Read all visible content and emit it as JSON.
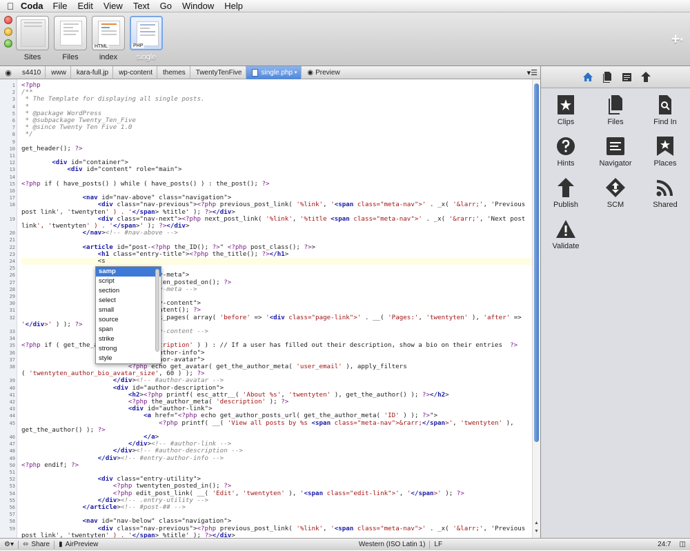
{
  "menubar": {
    "app": "Coda",
    "items": [
      "File",
      "Edit",
      "View",
      "Text",
      "Go",
      "Window",
      "Help"
    ]
  },
  "toolbar": {
    "buttons": [
      {
        "label": "Sites",
        "tag": ""
      },
      {
        "label": "Files",
        "tag": ""
      },
      {
        "label": "index",
        "tag": "HTML"
      },
      {
        "label": "single",
        "tag": "PHP"
      }
    ],
    "plus": "+"
  },
  "pathbar": {
    "crumbs": [
      "s4410",
      "www",
      "kara-full.jp",
      "wp-content",
      "themes",
      "TwentyTenFive"
    ],
    "current_file": "single.php",
    "preview_label": "Preview"
  },
  "editor": {
    "line_numbers": [
      "1",
      "2",
      "3",
      "4",
      "5",
      "6",
      "7",
      "8",
      "9",
      "10",
      "11",
      "12",
      "13",
      "14",
      "15",
      "16",
      "17",
      "18",
      "",
      "19",
      "",
      "20",
      "21",
      "22",
      "23",
      "24",
      "25",
      "26",
      "27",
      "28",
      "29",
      "30",
      "31",
      "32",
      "",
      "33",
      "34",
      "35",
      "36",
      "37",
      "38",
      "",
      "39",
      "40",
      "41",
      "42",
      "43",
      "44",
      "45",
      "",
      "46",
      "47",
      "48",
      "49",
      "50",
      "51",
      "52",
      "53",
      "54",
      "55",
      "56",
      "57",
      "58",
      "59",
      ""
    ],
    "lines": [
      "<?php",
      "/**",
      " * The Template for displaying all single posts.",
      " *",
      " * @package WordPress",
      " * @subpackage Twenty_Ten_Five",
      " * @since Twenty Ten Five 1.0",
      " */",
      "",
      "get_header(); ?>",
      "",
      "        <div id=\"container\">",
      "            <div id=\"content\" role=\"main\">",
      "",
      "<?php if ( have_posts() ) while ( have_posts() ) : the_post(); ?>",
      "",
      "                <nav id=\"nav-above\" class=\"navigation\">",
      "                    <div class=\"nav-previous\"><?php previous_post_link( '%link', '<span class=\"meta-nav\">' . _x( '&larr;', 'Previous",
      "post link', 'twentyten' ) . '</span> %title' ); ?></div>",
      "                    <div class=\"nav-next\"><?php next_post_link( '%link', '%title <span class=\"meta-nav\">' . _x( '&rarr;', 'Next post",
      "link', 'twentyten' ) . '</span>' ); ?></div>",
      "                </nav><!-- #nav-above -->",
      "",
      "                <article id=\"post-<?php the_ID(); ?>\" <?php post_class(); ?>>",
      "                    <h1 class=\"entry-title\"><?php the_title(); ?></h1>",
      "                    <s",
      "",
      "                    <div class=\"entry-meta\">",
      "                        <?php twentyten_posted_on(); ?>",
      "                    </div><!-- .entry-meta -->",
      "",
      "                    <div class=\"entry-content\">",
      "                        <?php the_content(); ?>",
      "                        <?php wp_link_pages( array( 'before' => '<div class=\"page-link\">' . __( 'Pages:', 'twentyten' ), 'after' =>",
      "'</div>' ) ); ?>",
      "                    </div><!-- .entry-content -->",
      "",
      "<?php if ( get_the_author_meta( 'description' ) ) : // If a user has filled out their description, show a bio on their entries  ?>",
      "                    <div id=\"entry-author-info\">",
      "                        <div id=\"author-avatar\">",
      "                            <?php echo get_avatar( get_the_author_meta( 'user_email' ), apply_filters",
      "( 'twentyten_author_bio_avatar_size', 60 ) ); ?>",
      "                        </div><!-- #author-avatar -->",
      "                        <div id=\"author-description\">",
      "                            <h2><?php printf( esc_attr__( 'About %s', 'twentyten' ), get_the_author() ); ?></h2>",
      "                            <?php the_author_meta( 'description' ); ?>",
      "                            <div id=\"author-link\">",
      "                                <a href=\"<?php echo get_author_posts_url( get_the_author_meta( 'ID' ) ); ?>\">",
      "                                    <?php printf( __( 'View all posts by %s <span class=\"meta-nav\">&rarr;</span>', 'twentyten' ),",
      "get_the_author() ); ?>",
      "                                </a>",
      "                            </div><!-- #author-link -->",
      "                        </div><!-- #author-description -->",
      "                    </div><!-- #entry-author-info -->",
      "<?php endif; ?>",
      "",
      "                    <div class=\"entry-utility\">",
      "                        <?php twentyten_posted_in(); ?>",
      "                        <?php edit_post_link( __( 'Edit', 'twentyten' ), '<span class=\"edit-link\">', '</span>' ); ?>",
      "                    </div><!-- .entry-utility -->",
      "                </article><!-- #post-## -->",
      "",
      "                <nav id=\"nav-below\" class=\"navigation\">",
      "                    <div class=\"nav-previous\"><?php previous_post_link( '%link', '<span class=\"meta-nav\">' . _x( '&larr;', 'Previous",
      "post link', 'twentyten' ) . '</span> %title' ); ?></div>"
    ],
    "current_line_index": 25
  },
  "autocomplete": {
    "items": [
      "samp",
      "script",
      "section",
      "select",
      "small",
      "source",
      "span",
      "strike",
      "strong",
      "style"
    ],
    "selected": 0
  },
  "sidebar": {
    "items": [
      {
        "label": "Clips",
        "icon": "clips-icon"
      },
      {
        "label": "Files",
        "icon": "files-icon"
      },
      {
        "label": "Find In",
        "icon": "find-in-icon"
      },
      {
        "label": "Hints",
        "icon": "hints-icon"
      },
      {
        "label": "Navigator",
        "icon": "navigator-icon"
      },
      {
        "label": "Places",
        "icon": "places-icon"
      },
      {
        "label": "Publish",
        "icon": "publish-icon"
      },
      {
        "label": "SCM",
        "icon": "scm-icon"
      },
      {
        "label": "Shared",
        "icon": "shared-icon"
      },
      {
        "label": "Validate",
        "icon": "validate-icon"
      }
    ]
  },
  "status": {
    "share": "Share",
    "airpreview": "AirPreview",
    "encoding": "Western (ISO Latin 1)",
    "line_ending": "LF",
    "position": "24:7"
  }
}
